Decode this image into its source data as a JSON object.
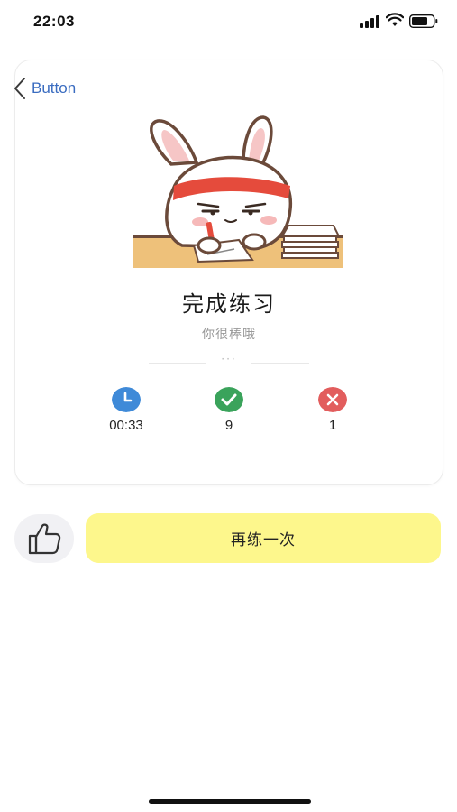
{
  "status_bar": {
    "time": "22:03"
  },
  "nav": {
    "back_label": "Button"
  },
  "result": {
    "title": "完成练习",
    "subtitle": "你很棒哦",
    "divider_dots": "···"
  },
  "stats": [
    {
      "icon": "clock-icon",
      "value": "00:33",
      "color": "#3f8ad8"
    },
    {
      "icon": "check-icon",
      "value": "9",
      "color": "#3aa35b"
    },
    {
      "icon": "cross-icon",
      "value": "1",
      "color": "#e25d5d"
    }
  ],
  "actions": {
    "like_icon": "thumbs-up-icon",
    "retry_label": "再练一次",
    "retry_color": "#fdf78c"
  }
}
